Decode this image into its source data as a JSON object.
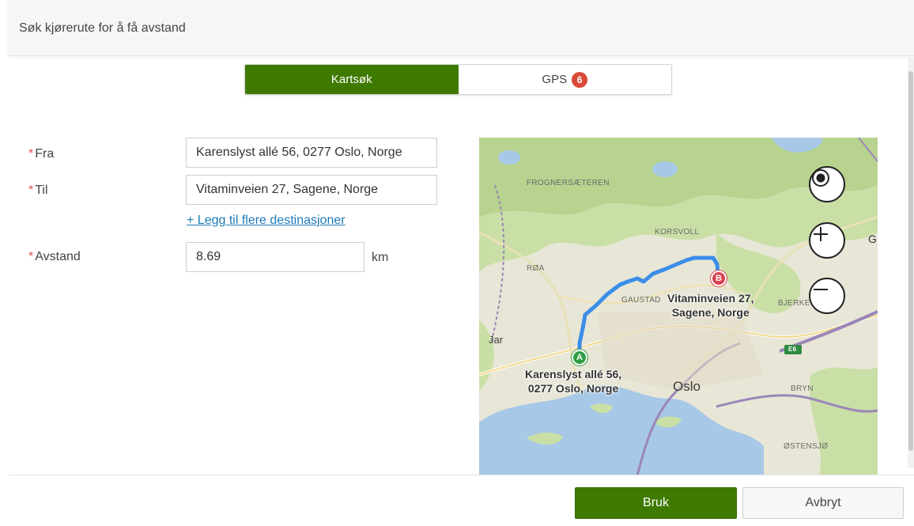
{
  "dialog": {
    "title": "Søk kjørerute for å få avstand"
  },
  "tabs": [
    {
      "label": "Kartsøk",
      "active": true
    },
    {
      "label": "GPS",
      "badge": "6",
      "active": false
    }
  ],
  "form": {
    "required_marker": "*",
    "from": {
      "label": "Fra",
      "value": "Karenslyst allé 56, 0277 Oslo, Norge"
    },
    "to": {
      "label": "Til",
      "value": "Vitaminveien 27, Sagene, Norge"
    },
    "add_destinations_link": "+ Legg til flere destinasjoner",
    "distance": {
      "label": "Avstand",
      "value": "8.69",
      "unit": "km"
    }
  },
  "map": {
    "place_labels": {
      "frognersaeteren": "FROGNERSÆTEREN",
      "korsvoll": "KORSVOLL",
      "roa": "RØA",
      "gaustad": "GAUSTAD",
      "bjerke": "BJERKE",
      "jar": "Jar",
      "oslo": "Oslo",
      "bryn": "BRYN",
      "ostensjo": "ØSTENSJØ",
      "g": "G",
      "e6": "E6"
    },
    "start_marker": {
      "letter": "A",
      "label_line1": "Karenslyst allé 56,",
      "label_line2": "0277 Oslo, Norge"
    },
    "end_marker": {
      "letter": "B",
      "label_line1": "Vitaminveien 27,",
      "label_line2": "Sagene, Norge"
    },
    "controls": {
      "locate_icon": "locate-icon",
      "zoom_in_icon": "zoom-in-icon",
      "zoom_out_icon": "zoom-out-icon"
    },
    "route_color": "#3b8ee8",
    "start_color": "#2e9e45",
    "end_color": "#d9434f"
  },
  "footer": {
    "apply_label": "Bruk",
    "cancel_label": "Avbryt"
  },
  "colors": {
    "primary": "#3e7a00",
    "badge": "#d94a38",
    "link": "#1e7ab7",
    "required": "#d9534f"
  }
}
